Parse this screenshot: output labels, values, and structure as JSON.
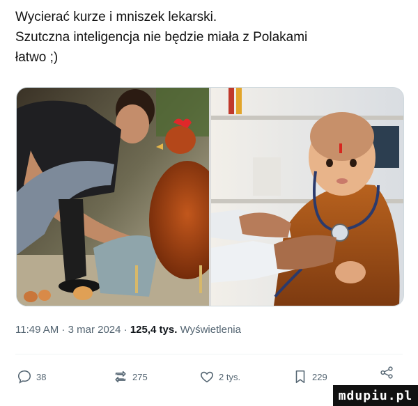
{
  "post": {
    "lines": [
      "Wycierać kurze i mniszek lekarski.",
      "Szutczna inteligencja nie będzie miała z Polakami",
      "łatwo ;)"
    ]
  },
  "meta": {
    "time": "11:49 AM",
    "sep1": " · ",
    "date": "3 mar 2024",
    "sep2": " · ",
    "views": "125,4 tys.",
    "views_label": " Wyświetlenia"
  },
  "actions": {
    "replies": "38",
    "reposts": "275",
    "likes": "2 tys.",
    "bookmarks": "229"
  },
  "watermark": "mdupiu.pl",
  "icons": [
    "reply-icon",
    "repost-icon",
    "like-icon",
    "bookmark-icon",
    "share-icon"
  ]
}
